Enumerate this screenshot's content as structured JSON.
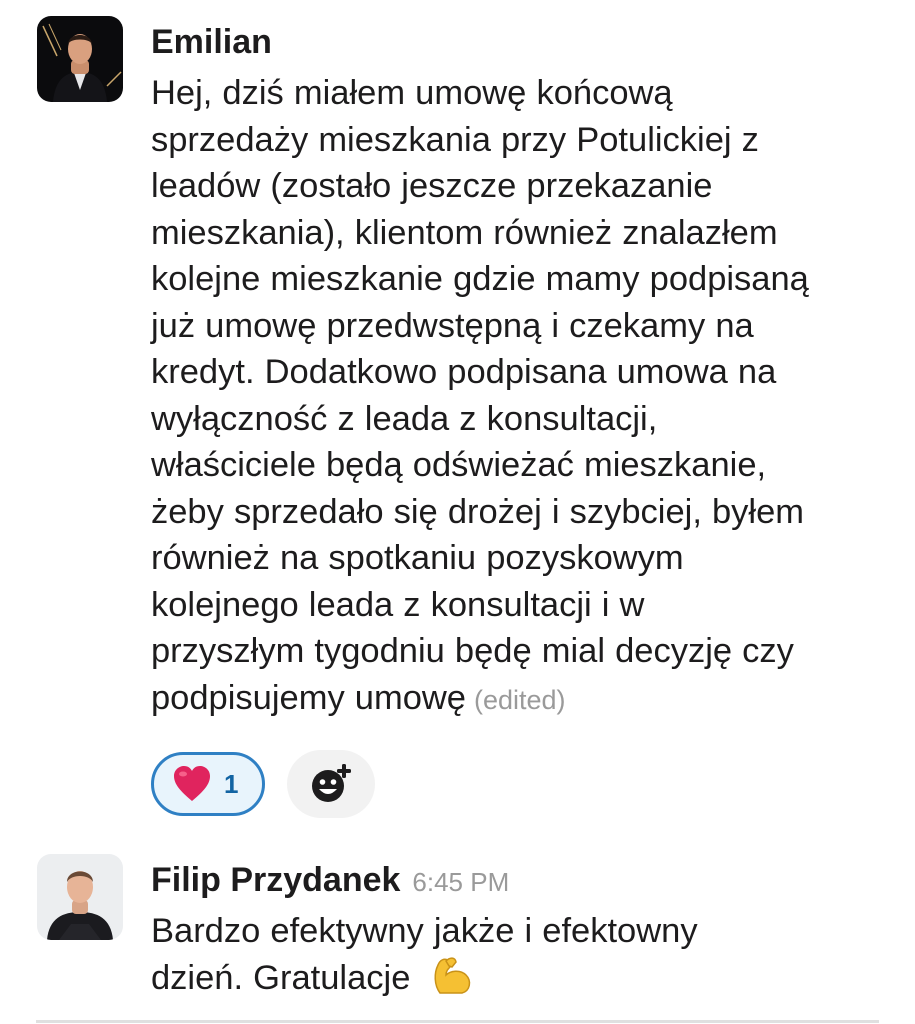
{
  "messages": [
    {
      "sender": "Emilian",
      "timestamp": "",
      "avatar_icon": "user-photo-avatar",
      "lines": [
        "Hej, dziś miałem umowę końcową",
        "sprzedaży mieszkania przy Potulickiej z",
        "leadów (zostało jeszcze przekazanie",
        "mieszkania), klientom również znalazłem",
        "kolejne mieszkanie gdzie mamy podpisaną",
        "już umowę przedwstępną i czekamy na",
        "kredyt. Dodatkowo podpisana umowa na",
        "wyłączność z leada z konsultacji,",
        "właściciele będą odświeżać mieszkanie,",
        "żeby sprzedało się drożej i szybciej, byłem",
        "również na spotkaniu pozyskowym",
        "kolejnego leada z konsultacji i w",
        "przyszłym tygodniu będę mial decyzję czy",
        "podpisujemy umowę"
      ],
      "edited_label": "(edited)",
      "reactions": [
        {
          "emoji": "❤️",
          "icon": "red-heart-emoji",
          "count": "1"
        }
      ],
      "add_reaction_icon": "add-reaction-icon"
    },
    {
      "sender": "Filip Przydanek",
      "timestamp": "6:45 PM",
      "avatar_icon": "user-photo-avatar",
      "lines": [
        "Bardzo efektywny jakże i efektowny",
        "dzień. Gratulacje"
      ],
      "trailing_emoji": "💪",
      "trailing_emoji_icon": "flexed-biceps-emoji"
    }
  ],
  "colors": {
    "text": "#1d1c1d",
    "muted": "#9a9a9a",
    "reaction_border": "#2f80c4",
    "reaction_bg": "#e8f4fc",
    "reaction_count": "#1264a3",
    "heart": "#e0245e",
    "biceps": "#f5c033"
  }
}
